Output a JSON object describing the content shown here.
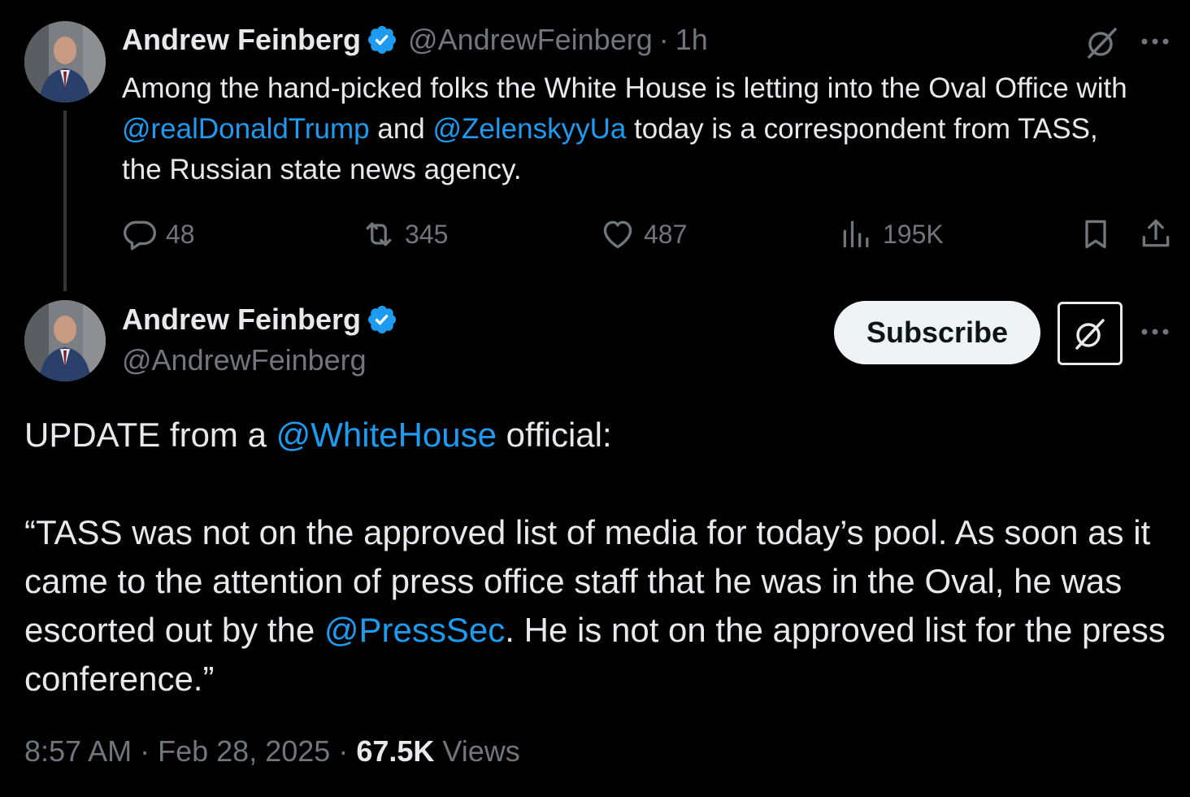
{
  "tweet1": {
    "name": "Andrew Feinberg",
    "handle": "@AndrewFeinberg",
    "sep": "·",
    "time": "1h",
    "text_a": "Among the hand-picked folks the White House is letting into the Oval Office with ",
    "mention_a": "@realDonaldTrump",
    "text_b": " and ",
    "mention_b": "@ZelenskyyUa",
    "text_c": " today is a correspondent from TASS, the Russian state news agency.",
    "replies": "48",
    "reposts": "345",
    "likes": "487",
    "views": "195K"
  },
  "tweet2": {
    "name": "Andrew Feinberg",
    "handle": "@AndrewFeinberg",
    "subscribe_label": "Subscribe",
    "p1_a": "UPDATE from a ",
    "p1_mention": "@WhiteHouse",
    "p1_b": " official:",
    "p2_a": "“TASS was not on the approved list of media for today’s pool. As soon as it came to the attention of press office staff that he was in the Oval, he was escorted out by the ",
    "p2_mention": "@PressSec",
    "p2_b": ". He is not on the approved list for the press conference.”",
    "time": "8:57 AM",
    "sep1": "·",
    "date": "Feb 28, 2025",
    "sep2": "·",
    "views_count": "67.5K",
    "views_label": "Views"
  },
  "colors": {
    "background": "#000000",
    "text": "#e7e9ea",
    "muted": "#71767b",
    "accent": "#1d9bf0"
  },
  "icons": [
    "verified-badge-icon",
    "grok-icon",
    "more-icon",
    "reply-icon",
    "repost-icon",
    "like-icon",
    "views-icon",
    "bookmark-icon",
    "share-icon"
  ]
}
